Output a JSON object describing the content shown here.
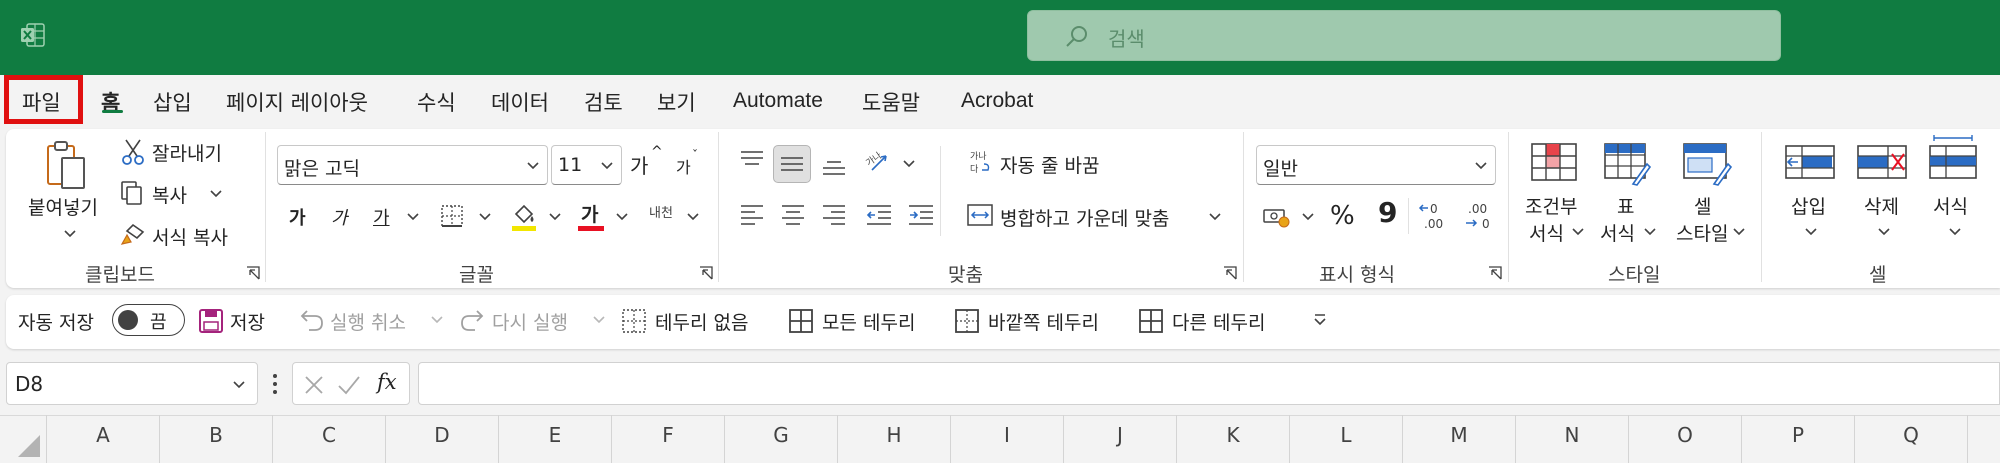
{
  "search": {
    "placeholder": "검색"
  },
  "tabs": [
    {
      "id": "file",
      "label": "파일"
    },
    {
      "id": "home",
      "label": "홈"
    },
    {
      "id": "insert",
      "label": "삽입"
    },
    {
      "id": "page-layout",
      "label": "페이지 레이아웃"
    },
    {
      "id": "formulas",
      "label": "수식"
    },
    {
      "id": "data",
      "label": "데이터"
    },
    {
      "id": "review",
      "label": "검토"
    },
    {
      "id": "view",
      "label": "보기"
    },
    {
      "id": "automate",
      "label": "Automate"
    },
    {
      "id": "help",
      "label": "도움말"
    },
    {
      "id": "acrobat",
      "label": "Acrobat"
    }
  ],
  "ribbon": {
    "clipboard": {
      "label": "클립보드",
      "paste": "붙여넣기",
      "cut": "잘라내기",
      "copy": "복사",
      "format_painter": "서식 복사"
    },
    "font": {
      "label": "글꼴",
      "font_name": "맑은 고딕",
      "font_size": "11",
      "grow": "가",
      "shrink": "가",
      "bold": "가",
      "italic": "가",
      "underline": "가",
      "font_color": "가",
      "phonetic": "내천"
    },
    "alignment": {
      "label": "맞춤",
      "wrap_text": "자동 줄 바꿈",
      "merge_center": "병합하고 가운데 맞춤",
      "orientation": "가나"
    },
    "number": {
      "label": "표시 형식",
      "format": "일반",
      "percent": "%",
      "comma": "9",
      "inc_decimal": "←0 .00",
      "dec_decimal": ".00 →0"
    },
    "styles": {
      "label": "스타일",
      "conditional_1": "조건부",
      "conditional_2": "서식",
      "table_1": "표",
      "table_2": "서식",
      "cell_1": "셀",
      "cell_2": "스타일"
    },
    "cells": {
      "label": "셀",
      "insert": "삽입",
      "delete": "삭제",
      "format": "서식"
    }
  },
  "qat": {
    "autosave": "자동 저장",
    "toggle": "끔",
    "save": "저장",
    "undo": "실행 취소",
    "redo": "다시 실행",
    "no_border": "테두리 없음",
    "all_borders": "모든 테두리",
    "outside_borders": "바깥쪽 테두리",
    "more_borders": "다른 테두리"
  },
  "formula_bar": {
    "name_box": "D8",
    "fx": "fx",
    "value": ""
  },
  "columns": [
    "A",
    "B",
    "C",
    "D",
    "E",
    "F",
    "G",
    "H",
    "I",
    "J",
    "K",
    "L",
    "M",
    "N",
    "O",
    "P",
    "Q"
  ],
  "colors": {
    "accent": "#107c41",
    "highlight_box": "#e01010",
    "highlight_yellow": "#f2e600",
    "font_red": "#e81123"
  }
}
